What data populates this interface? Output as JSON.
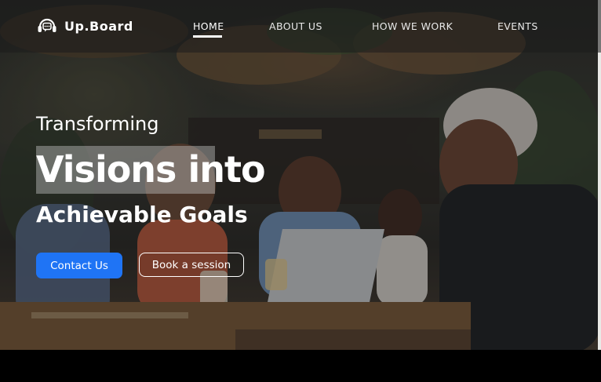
{
  "brand": {
    "name": "Up.Board",
    "icon": "headset-chat-icon"
  },
  "nav": {
    "items": [
      {
        "label": "HOME",
        "active": true
      },
      {
        "label": "ABOUT US",
        "active": false
      },
      {
        "label": "HOW WE WORK",
        "active": false
      },
      {
        "label": "EVENTS",
        "active": false
      }
    ]
  },
  "hero": {
    "line1": "Transforming",
    "line2": "Visions into",
    "line3": "Achievable Goals",
    "primary_button": "Contact Us",
    "secondary_button": "Book a session"
  },
  "colors": {
    "accent": "#1f74f5",
    "text": "#ffffff",
    "navbar_bg": "#1c1c1c",
    "footer_band": "#000000"
  }
}
